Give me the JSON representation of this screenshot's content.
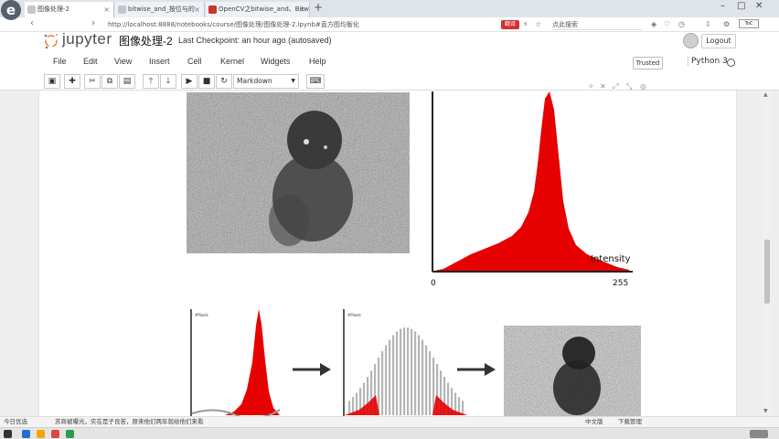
{
  "browser": {
    "logo": "e",
    "tabs": [
      {
        "label": "图像处理-2",
        "active": true
      },
      {
        "label": "bitwise_and_按位与的",
        "active": false
      },
      {
        "label": "OpenCV之bitwise_and、Bitwi",
        "active": false
      }
    ],
    "new_tab": "+",
    "url": "http://localhost:8888/notebooks/course/图像处理/图像处理-2.ipynb#直方图均衡化",
    "search_text": "点此搜索",
    "translate_label": "翻译"
  },
  "notebook": {
    "brand": "jupyter",
    "title": "图像处理-2",
    "checkpoint": "Last Checkpoint: an hour ago (autosaved)",
    "logout_label": "Logout",
    "sidebar_tag": "ToC",
    "menu": [
      "File",
      "Edit",
      "View",
      "Insert",
      "Cell",
      "Kernel",
      "Widgets",
      "Help"
    ],
    "trusted_label": "Trusted",
    "kernel_name": "Python 3",
    "cell_type": "Markdown",
    "toolbar_icons": [
      "save-icon",
      "plus-icon",
      "cut-icon",
      "copy-icon",
      "paste-icon",
      "arrow-up-icon",
      "arrow-down-icon",
      "run-icon",
      "stop-icon",
      "restart-icon",
      "keyboard-icon"
    ]
  },
  "figure": {
    "hist_label": "Intensity",
    "x_min_label": "0",
    "x_max_label": "255",
    "small_hist_ylabel": "#Pixels"
  },
  "status": {
    "left_text": "今日优选",
    "message": "苏商被曝光，实在是子良苦，原来他们两年就给他们来看",
    "right_text": "中文版",
    "right_text2": "下载管理"
  },
  "colors": {
    "hist_fill": "#e60000",
    "bar_grey": "#b5b5b5",
    "accent_red": "#d4312f"
  }
}
